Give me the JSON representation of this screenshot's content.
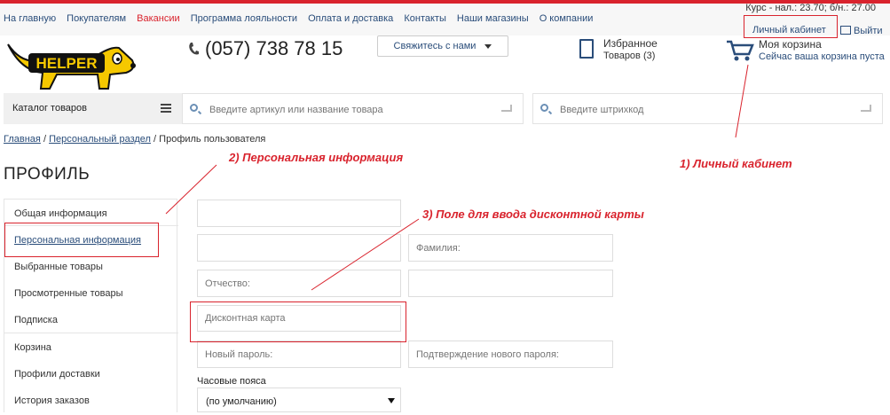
{
  "nav": [
    {
      "label": "На главную",
      "color": "#2a4d7a"
    },
    {
      "label": "Покупателям",
      "color": "#2a4d7a"
    },
    {
      "label": "Вакансии",
      "color": "#d9232d"
    },
    {
      "label": "Программа лояльности",
      "color": "#2a4d7a"
    },
    {
      "label": "Оплата и доставка",
      "color": "#2a4d7a"
    },
    {
      "label": "Контакты",
      "color": "#2a4d7a"
    },
    {
      "label": "Наши магазины",
      "color": "#2a4d7a"
    },
    {
      "label": "О компании",
      "color": "#2a4d7a"
    }
  ],
  "header": {
    "rate": "Курс - нал.: 23.70; б/н.: 27.00",
    "cabinet": "Личный кабинет",
    "logout": "Выйти",
    "logo_text": "HELPER",
    "phone": "(057) 738 78 15",
    "contact_button": "Свяжитесь с нами",
    "favorites_title": "Избранное",
    "favorites_count": "Товаров (3)",
    "cart_title": "Моя корзина",
    "cart_status": "Сейчас ваша корзина пуста"
  },
  "toolbar": {
    "catalog": "Каталог товаров",
    "search_placeholder": "Введите артикул или название товара",
    "barcode_placeholder": "Введите штрихкод"
  },
  "breadcrumb": {
    "home": "Главная",
    "section": "Персональный раздел",
    "current": "Профиль пользователя",
    "sep": "/"
  },
  "page_title": "ПРОФИЛЬ",
  "menu": [
    "Общая информация",
    "Персональная информация",
    "Выбранные товары",
    "Просмотренные товары",
    "Подписка",
    "Корзина",
    "Профили доставки",
    "История заказов"
  ],
  "form": {
    "field1_value": "",
    "field2_value": "",
    "surname_placeholder": "Фамилия:",
    "patronymic_placeholder": "Отчество:",
    "field5_value": "",
    "discount_placeholder": "Дисконтная карта",
    "new_password_placeholder": "Новый пароль:",
    "confirm_password_placeholder": "Подтверждение нового пароля:",
    "timezone_label": "Часовые пояса",
    "timezone_value": "(по умолчанию)"
  },
  "annotations": {
    "a1": "1) Личный кабинет",
    "a2": "2) Персональная информация",
    "a3": "3) Поле для ввода дисконтной карты"
  },
  "colors": {
    "accent": "#d9232d",
    "link": "#2a4d7a",
    "logo_yellow": "#f5c800"
  }
}
